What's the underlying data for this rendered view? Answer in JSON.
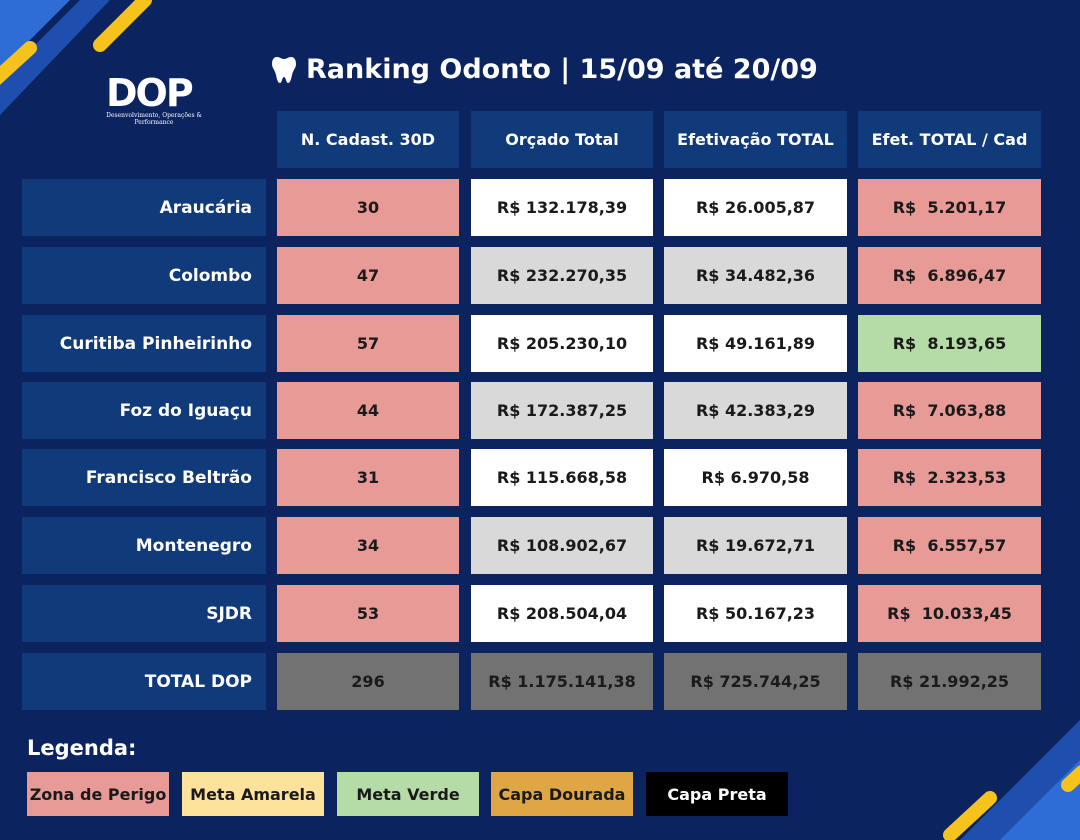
{
  "logo": {
    "text": "DOP",
    "subtitle": "Desenvolvimento, Operações & Performance"
  },
  "title": "Ranking Odonto | 15/09 até 20/09",
  "columns": [
    "N. Cadast. 30D",
    "Orçado Total",
    "Efetivação TOTAL",
    "Efet. TOTAL / Cad"
  ],
  "rows": [
    {
      "name": "Araucária",
      "cadast": "30",
      "orcado": "R$ 132.178,39",
      "efetivacao": "R$ 26.005,87",
      "efet_cad": "R$  5.201,17",
      "bg": "white",
      "efet_cad_color": "red"
    },
    {
      "name": "Colombo",
      "cadast": "47",
      "orcado": "R$ 232.270,35",
      "efetivacao": "R$ 34.482,36",
      "efet_cad": "R$  6.896,47",
      "bg": "grey",
      "efet_cad_color": "red"
    },
    {
      "name": "Curitiba Pinheirinho",
      "cadast": "57",
      "orcado": "R$ 205.230,10",
      "efetivacao": "R$ 49.161,89",
      "efet_cad": "R$  8.193,65",
      "bg": "white",
      "efet_cad_color": "green"
    },
    {
      "name": "Foz do Iguaçu",
      "cadast": "44",
      "orcado": "R$ 172.387,25",
      "efetivacao": "R$ 42.383,29",
      "efet_cad": "R$  7.063,88",
      "bg": "grey",
      "efet_cad_color": "red"
    },
    {
      "name": "Francisco Beltrão",
      "cadast": "31",
      "orcado": "R$ 115.668,58",
      "efetivacao": "R$ 6.970,58",
      "efet_cad": "R$  2.323,53",
      "bg": "white",
      "efet_cad_color": "red"
    },
    {
      "name": "Montenegro",
      "cadast": "34",
      "orcado": "R$ 108.902,67",
      "efetivacao": "R$ 19.672,71",
      "efet_cad": "R$  6.557,57",
      "bg": "grey",
      "efet_cad_color": "red"
    },
    {
      "name": "SJDR",
      "cadast": "53",
      "orcado": "R$ 208.504,04",
      "efetivacao": "R$ 50.167,23",
      "efet_cad": "R$  10.033,45",
      "bg": "white",
      "efet_cad_color": "red"
    }
  ],
  "total": {
    "name": "TOTAL DOP",
    "cadast": "296",
    "orcado": "R$ 1.175.141,38",
    "efetivacao": "R$ 725.744,25",
    "efet_cad": "R$ 21.992,25"
  },
  "legend": {
    "title": "Legenda:",
    "items": [
      {
        "label": "Zona de Perigo",
        "color": "#e89a97",
        "text_color": "#1a1a1a"
      },
      {
        "label": "Meta Amarela",
        "color": "#fde29b",
        "text_color": "#1a1a1a"
      },
      {
        "label": "Meta Verde",
        "color": "#b5dca7",
        "text_color": "#1a1a1a"
      },
      {
        "label": "Capa Dourada",
        "color": "#e0a646",
        "text_color": "#1a1a1a"
      },
      {
        "label": "Capa Preta",
        "color": "#000000",
        "text_color": "#ffffff"
      }
    ]
  },
  "colors": {
    "background": "#0b2460",
    "header": "#113a7a",
    "red": "#e89a97",
    "green": "#b5dca7",
    "grey": "#d9d9d9",
    "total": "#727272",
    "accent_yellow": "#f6c21c",
    "accent_blue": "#2e6dd6"
  }
}
